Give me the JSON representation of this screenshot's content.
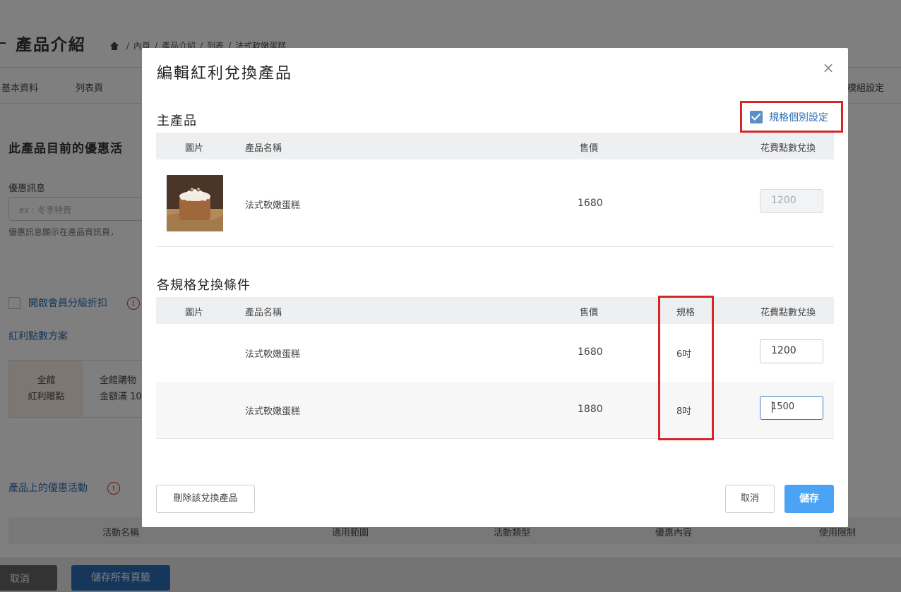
{
  "background": {
    "page_title": "產品介紹",
    "breadcrumb": [
      "內頁",
      "/",
      "產品介紹",
      "/",
      "列表",
      "/",
      "法式軟嫩蛋糕"
    ],
    "tabs": [
      "基本資料",
      "列表頁",
      "模組設定"
    ],
    "section_title": "此產品目前的優惠活",
    "promo_label": "優惠訊息",
    "promo_placeholder": "ex : 冬季特賣",
    "promo_hint": "優惠訊息顯示在產品資訊頁，",
    "member_discount_label": "開啟會員分級折扣",
    "bonus_plan_link": "紅利點數方案",
    "card": {
      "left_line1": "全館",
      "left_line2": "紅利贈點",
      "right_line1": "全館購物",
      "right_line2": "金額滿 10"
    },
    "activities_link": "產品上的優惠活動",
    "activity_columns": [
      "活動名稱",
      "適用範圍",
      "活動類型",
      "優惠內容",
      "使用限制"
    ],
    "cancel_label": "取消",
    "save_all_label": "儲存所有頁籤"
  },
  "modal": {
    "title": "編輯紅利兌換產品",
    "close_symbol": "×",
    "spec_toggle_label": "規格個別設定",
    "spec_toggle_checked": true,
    "main_product": {
      "heading": "主產品",
      "columns": [
        "圖片",
        "產品名稱",
        "售價",
        "花費點數兌換"
      ],
      "row": {
        "name": "法式軟嫩蛋糕",
        "price": "1680",
        "points": "1200"
      }
    },
    "variants": {
      "heading": "各規格兌換條件",
      "columns": [
        "圖片",
        "產品名稱",
        "售價",
        "規格",
        "花費點數兌換"
      ],
      "rows": [
        {
          "name": "法式軟嫩蛋糕",
          "price": "1680",
          "spec": "6吋",
          "points": "1200"
        },
        {
          "name": "法式軟嫩蛋糕",
          "price": "1880",
          "spec": "8吋",
          "points": "1500"
        }
      ]
    },
    "delete_label": "刪除該兌換產品",
    "cancel_label": "取消",
    "save_label": "儲存"
  },
  "colors": {
    "highlight": "#d62728",
    "save_button": "#4aa3f5",
    "link": "#2a6fb6"
  }
}
